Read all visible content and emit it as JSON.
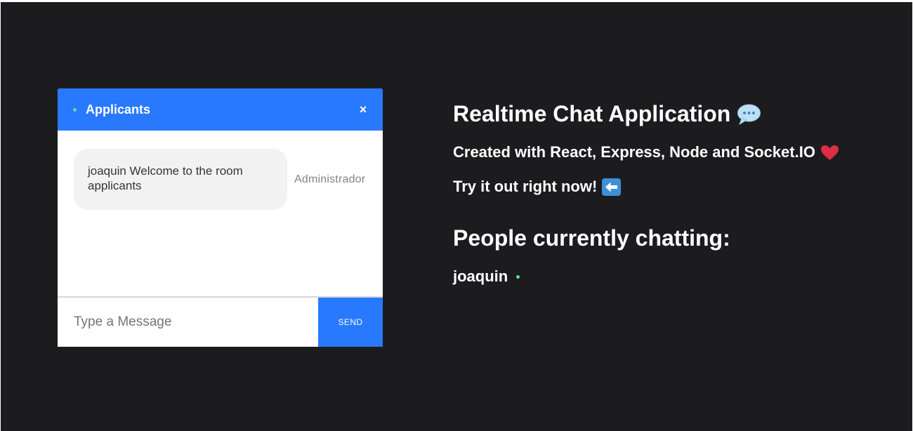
{
  "chat": {
    "room_name": "Applicants",
    "close_label": "×",
    "messages": [
      {
        "text": "joaquin Welcome to the room applicants",
        "sender": "Administrador"
      }
    ],
    "input_placeholder": "Type a Message",
    "send_label": "SEND"
  },
  "info": {
    "title": "Realtime Chat Application",
    "subtitle": "Created with React, Express, Node and Socket.IO",
    "cta": "Try it out right now!",
    "people_heading": "People currently chatting:",
    "users": [
      "joaquin"
    ]
  },
  "icons": {
    "title_icon": "speech-bubble-icon",
    "subtitle_icon": "heart-icon",
    "cta_icon": "left-arrow-icon",
    "online_indicator": "online-dot-icon"
  },
  "colors": {
    "background": "#1c1c1e",
    "accent": "#2979ff",
    "online": "#5ce0a8",
    "heart": "#dd2e44",
    "bubble": "#f2f2f2"
  }
}
